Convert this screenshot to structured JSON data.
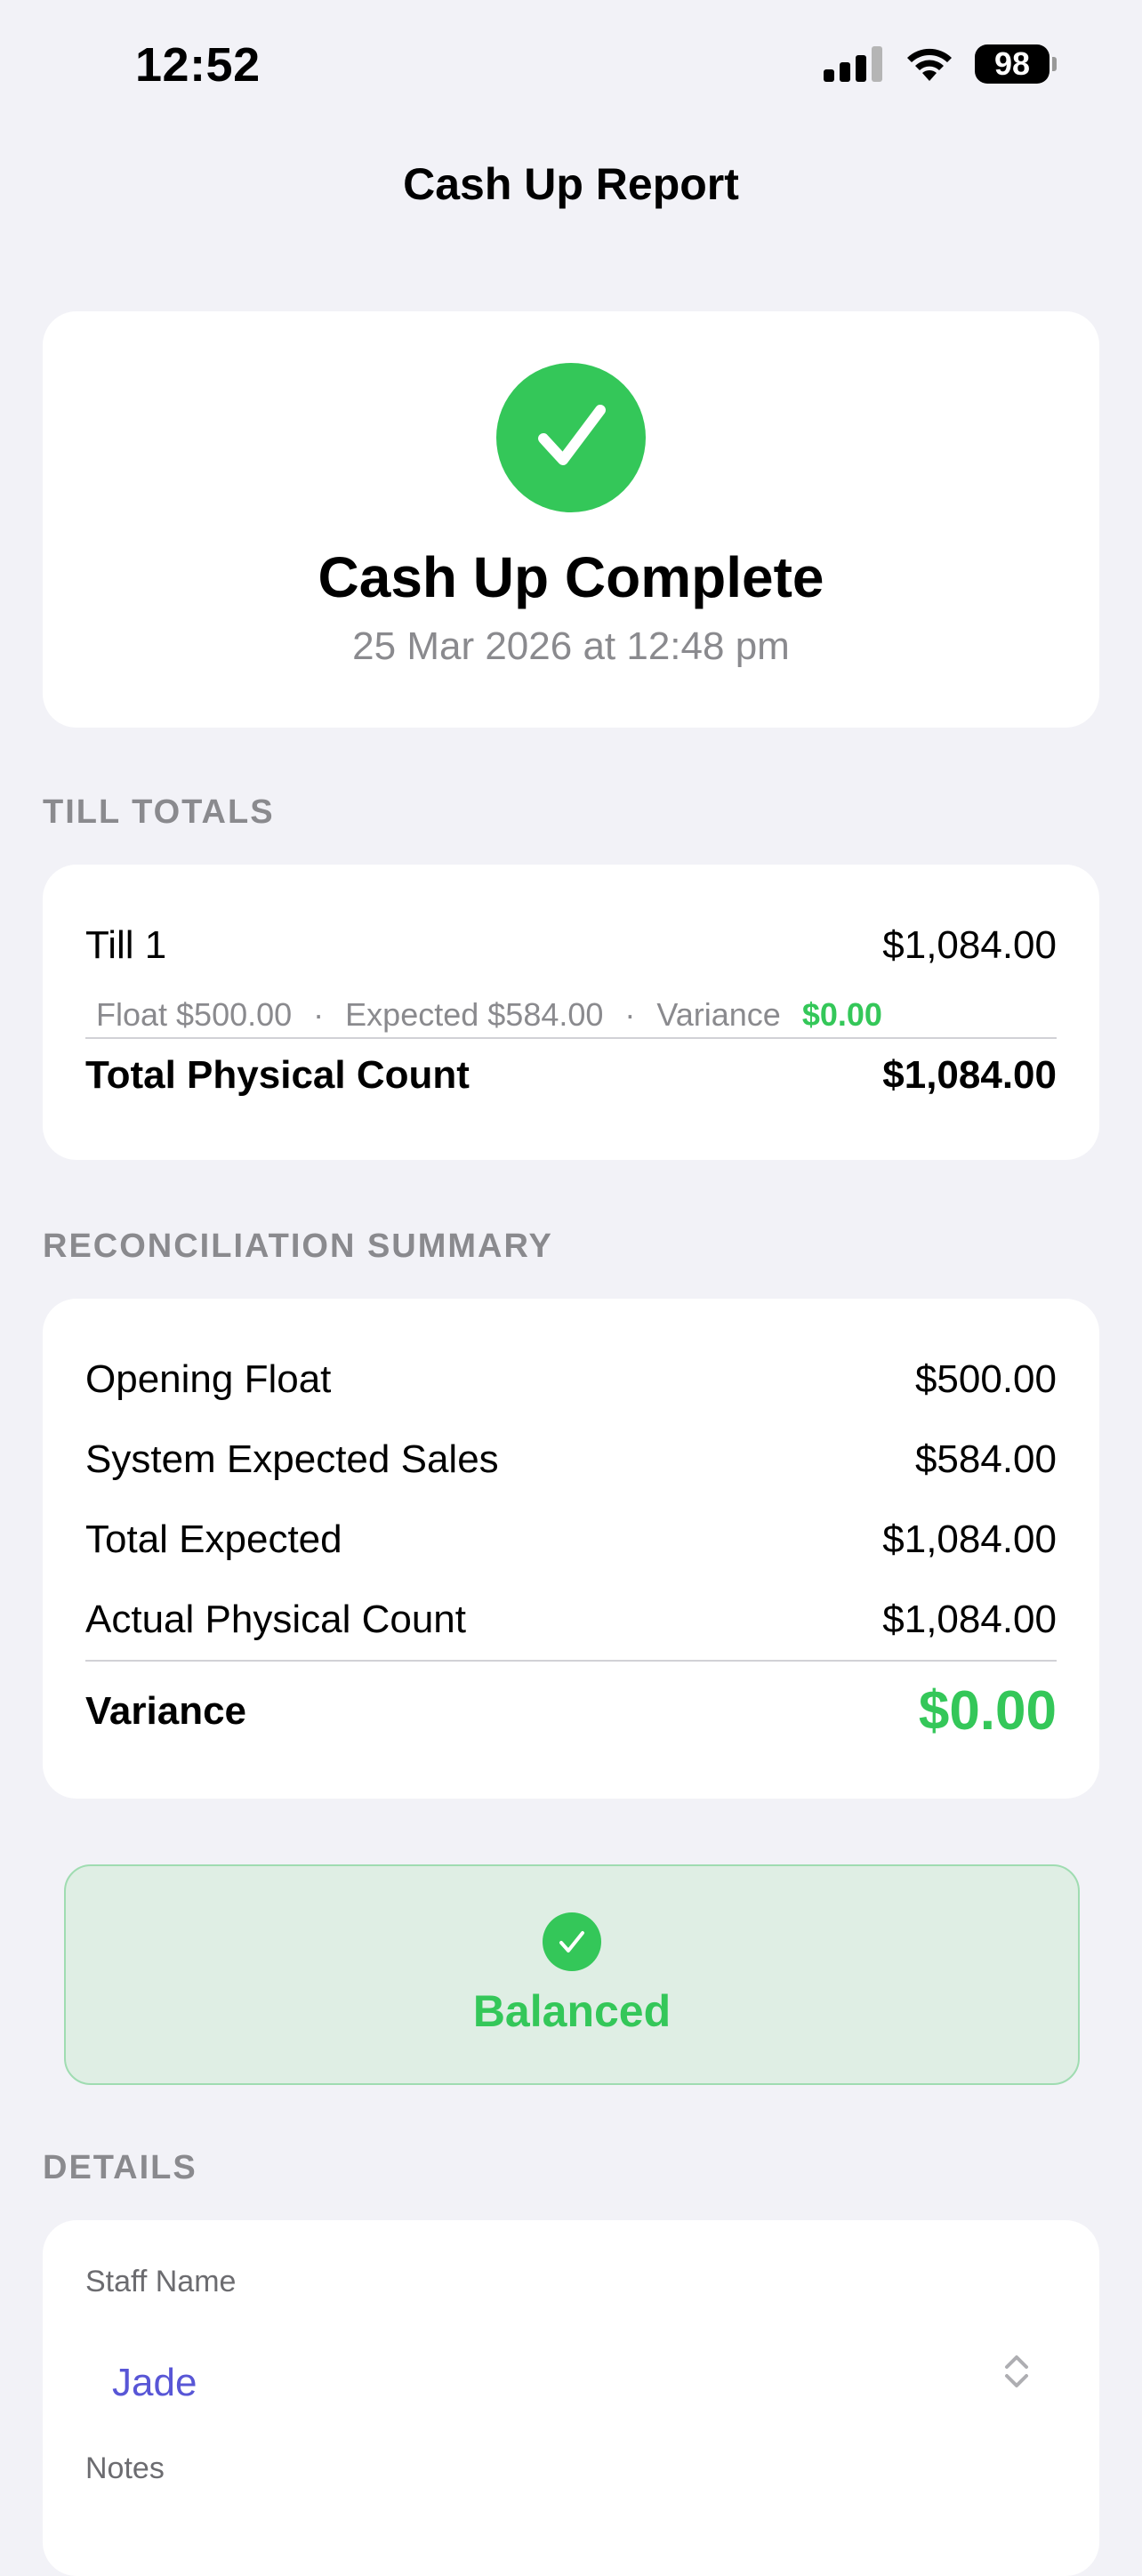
{
  "status_bar": {
    "time": "12:52",
    "battery": "98",
    "icons": [
      "signal-icon",
      "wifi-icon",
      "battery-icon"
    ]
  },
  "nav": {
    "title": "Cash Up Report"
  },
  "hero": {
    "icon": "checkmark-circle-icon",
    "title": "Cash Up Complete",
    "date": "25 Mar 2026 at 12:48 pm"
  },
  "till_totals": {
    "section_label": "TILL TOTALS",
    "till_name": "Till 1",
    "till_amount": "$1,084.00",
    "float_text": "Float $500.00",
    "expected_text": "Expected $584.00",
    "variance_label": "Variance",
    "variance_value": "$0.00",
    "separator": "·",
    "total_label": "Total Physical Count",
    "total_value": "$1,084.00"
  },
  "reconciliation": {
    "section_label": "RECONCILIATION SUMMARY",
    "rows": [
      {
        "label": "Opening Float",
        "value": "$500.00"
      },
      {
        "label": "System Expected Sales",
        "value": "$584.00"
      },
      {
        "label": "Total Expected",
        "value": "$1,084.00"
      },
      {
        "label": "Actual Physical Count",
        "value": "$1,084.00"
      }
    ],
    "variance_label": "Variance",
    "variance_value": "$0.00"
  },
  "balanced": {
    "label": "Balanced",
    "icon": "checkmark-circle-icon"
  },
  "details": {
    "section_label": "DETAILS",
    "staff_label": "Staff Name",
    "staff_value": "Jade",
    "notes_label": "Notes"
  },
  "colors": {
    "accent_green": "#34c759",
    "accent_purple": "#5856d6",
    "background": "#f2f2f7"
  }
}
